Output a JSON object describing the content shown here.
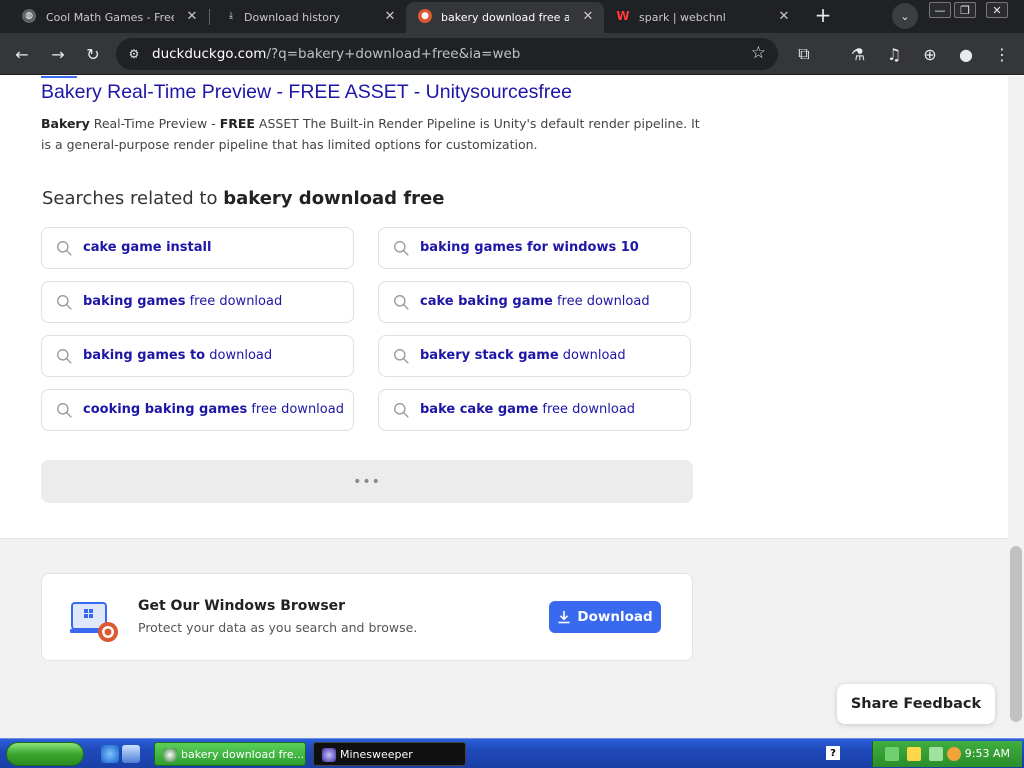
{
  "browser": {
    "tabs": [
      {
        "label": "Cool Math Games - Free O",
        "active": false
      },
      {
        "label": "Download history",
        "active": false
      },
      {
        "label": "bakery download free at D",
        "active": true
      },
      {
        "label": "spark | webchnl",
        "active": false
      }
    ],
    "new_tab_label": "+",
    "url_host": "duckduckgo.com",
    "url_path": "/?q=bakery+download+free&ia=web"
  },
  "result": {
    "title": "Bakery Real-Time Preview - FREE ASSET - Unitysourcesfree",
    "snippet_bold_1": "Bakery",
    "snippet_1": " Real-Time Preview - ",
    "snippet_bold_2": "FREE",
    "snippet_2": " ASSET The Built-in Render Pipeline is Unity's default render pipeline. It is a general-purpose render pipeline that has limited options for customization."
  },
  "related": {
    "heading_prefix": "Searches related to ",
    "heading_query": "bakery download free",
    "items": [
      {
        "bold": "cake game install",
        "rest": ""
      },
      {
        "bold": "baking games for windows 10",
        "rest": ""
      },
      {
        "bold": "baking games",
        "rest": " free download"
      },
      {
        "bold": "cake baking game",
        "rest": " free download"
      },
      {
        "bold": "baking games to",
        "rest": " download"
      },
      {
        "bold": "bakery stack game",
        "rest": " download"
      },
      {
        "bold": "cooking baking games",
        "rest": " free download"
      },
      {
        "bold": "bake cake game",
        "rest": " free download"
      }
    ],
    "more_label": "•••"
  },
  "promo": {
    "title": "Get Our Windows Browser",
    "subtitle": "Protect your data as you search and browse.",
    "button_label": "Download"
  },
  "feedback_label": "Share Feedback",
  "taskbar": {
    "tasks": [
      {
        "label": "bakery download fre..."
      },
      {
        "label": "Minesweeper"
      }
    ],
    "help_label": "?",
    "clock": "9:53 AM"
  },
  "colors": {
    "link": "#1e16a6",
    "accent": "#3969ef",
    "browser_dark": "#202124",
    "taskbar_blue": "#245edb"
  }
}
